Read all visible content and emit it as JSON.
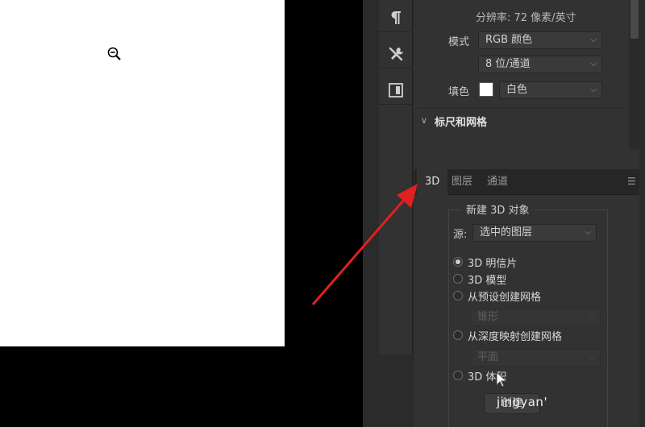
{
  "properties": {
    "resolution": "分辨率: 72 像素/英寸",
    "mode_label": "模式",
    "mode_value": "RGB 颜色",
    "depth_value": "8 位/通道",
    "fill_label": "填色",
    "fill_value": "白色",
    "ruler_section": "标尺和网格"
  },
  "tabs": [
    "3D",
    "图层",
    "通道"
  ],
  "three_d": {
    "group_title": "新建 3D 对象",
    "source_label": "源:",
    "source_value": "选中的图层",
    "options": [
      "3D 明信片",
      "3D 模型",
      "从预设创建网格",
      "从深度映射创建网格",
      "3D 体积"
    ],
    "preset_placeholder": "锥形",
    "depth_placeholder": "平面",
    "create_button": "创建"
  },
  "watermark": "jingyan'",
  "colors": {
    "arrow": "#e02020",
    "panel": "#323232",
    "canvas": "#ffffff"
  }
}
